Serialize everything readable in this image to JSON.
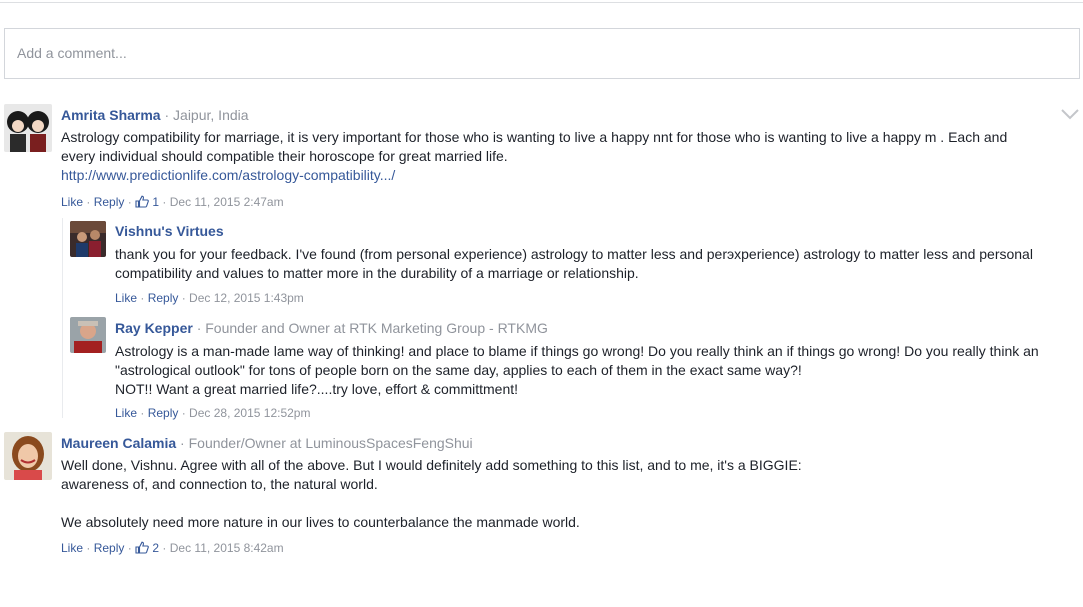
{
  "composer": {
    "placeholder": "Add a comment..."
  },
  "comments": [
    {
      "name": "Amrita Sharma",
      "meta": " · Jaipur, India",
      "lines": [
        "Astrology compatibility for marriage, it is very important for those who is wanting to live a happy nnt for those who is wanting to live a happy m              . Each and",
        "every individual should compatible their horoscope for great married life."
      ],
      "link": "http://www.predictionlife.com/astrology-compatibility.../",
      "actions": {
        "like": "Like",
        "reply": "Reply",
        "likes": "1",
        "time": "Dec 11, 2015 2:47am"
      }
    },
    {
      "name": "Vishnu's Virtues",
      "meta": "",
      "lines": [
        "thank you for your feedback. I've found (from personal experience) astrology to matter less and perэxperience) astrology to matter less and personal",
        "compatibility and values to matter more in the durability of a marriage or relationship."
      ],
      "actions": {
        "like": "Like",
        "reply": "Reply",
        "time": "Dec 12, 2015 1:43pm"
      }
    },
    {
      "name": "Ray Kepper",
      "meta": " · Founder and Owner at RTK Marketing Group - RTKMG",
      "lines": [
        "Astrology is a man-made lame way of thinking! and place to blame if things go wrong! Do you really think an if things go wrong! Do you really think an",
        "\"astrological outlook\" for tons of people born on the same day, applies to each of them in the exact same way?!",
        "NOT!! Want a great married life?....try love, effort & committment!"
      ],
      "actions": {
        "like": "Like",
        "reply": "Reply",
        "time": "Dec 28, 2015 12:52pm"
      }
    },
    {
      "name": "Maureen Calamia",
      "meta": " · Founder/Owner at LuminousSpacesFengShui",
      "lines": [
        "Well done, Vishnu. Agree with all of the above. But I would definitely add something to this list, and to me, it's a BIGGIE:",
        "awareness of, and connection to, the natural world.",
        "",
        "We absolutely need more nature in our lives to counterbalance the manmade world."
      ],
      "actions": {
        "like": "Like",
        "reply": "Reply",
        "likes": "2",
        "time": "Dec 11, 2015 8:42am"
      }
    }
  ],
  "sep": " · "
}
